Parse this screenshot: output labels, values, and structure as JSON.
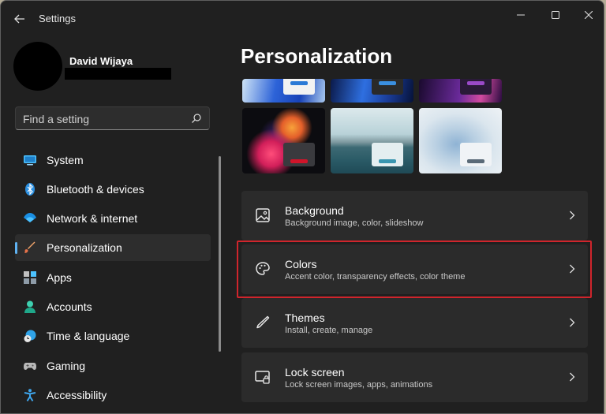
{
  "window": {
    "title": "Settings"
  },
  "profile": {
    "name": "David Wijaya"
  },
  "search": {
    "placeholder": "Find a setting"
  },
  "nav": {
    "items": [
      {
        "label": "System",
        "icon": "monitor-icon"
      },
      {
        "label": "Bluetooth & devices",
        "icon": "bluetooth-icon"
      },
      {
        "label": "Network & internet",
        "icon": "wifi-icon"
      },
      {
        "label": "Personalization",
        "icon": "brush-icon",
        "selected": true
      },
      {
        "label": "Apps",
        "icon": "apps-icon"
      },
      {
        "label": "Accounts",
        "icon": "person-icon"
      },
      {
        "label": "Time & language",
        "icon": "clock-globe-icon"
      },
      {
        "label": "Gaming",
        "icon": "gamepad-icon"
      },
      {
        "label": "Accessibility",
        "icon": "accessibility-icon"
      }
    ]
  },
  "page": {
    "title": "Personalization"
  },
  "cards": [
    {
      "title": "Background",
      "subtitle": "Background image, color, slideshow",
      "icon": "image-icon"
    },
    {
      "title": "Colors",
      "subtitle": "Accent color, transparency effects, color theme",
      "icon": "palette-icon"
    },
    {
      "title": "Themes",
      "subtitle": "Install, create, manage",
      "icon": "pen-icon"
    },
    {
      "title": "Lock screen",
      "subtitle": "Lock screen images, apps, animations",
      "icon": "lock-screen-icon"
    }
  ],
  "colors": {
    "accent": "#5fb2f2",
    "highlight": "#d0252c",
    "window_bg": "#202020",
    "card_bg": "#2b2b2b"
  }
}
